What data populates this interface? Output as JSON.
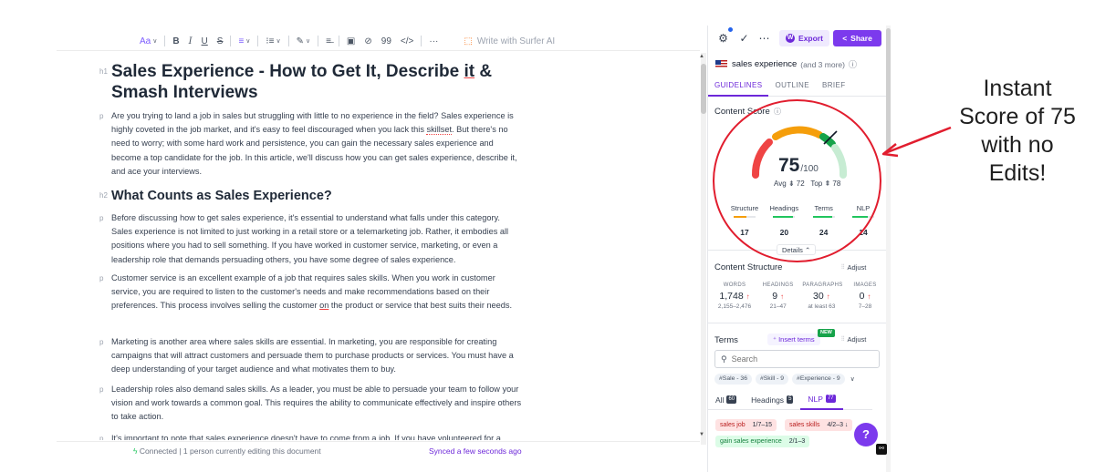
{
  "toolbar": {
    "text_style": "Aa",
    "bold": "B",
    "italic": "I",
    "underline": "U",
    "strike": "S",
    "align": "≡",
    "list": "⁝≡",
    "highlight": "✎",
    "clear": "≡̶",
    "image": "▣",
    "link": "⊘",
    "quote": "99",
    "code": "</>",
    "more": "···",
    "write_ai": "Write with Surfer AI"
  },
  "document": {
    "h1_tag": "h1",
    "h1_a": "Sales Experience - How to Get It, Describe ",
    "h1_b": "it",
    "h1_c": " & Smash Interviews",
    "p_tag": "p",
    "p1_a": "Are you trying to land a job in sales but struggling with little to no experience in the field? Sales experience is highly coveted in the job market, and it's easy to feel discouraged when you lack this ",
    "p1_b": "skillset",
    "p1_c": ". But there's no need to worry; with some hard work and persistence, you can gain the necessary sales experience and become a top candidate for the job. In this article, we'll discuss how you can get sales experience, describe it, and ace your interviews.",
    "h2_tag": "h2",
    "h2": "What Counts as Sales Experience?",
    "p2": "Before discussing how to get sales experience, it's essential to understand what falls under this category. Sales experience is not limited to just working in a retail store or a telemarketing job. Rather, it embodies all positions where you had to sell something. If you have worked in customer service, marketing, or even a leadership role that demands persuading others, you have some degree of sales experience.",
    "p3_a": "Customer service is an excellent example of a job that requires sales skills. When you work in customer service, you are required to listen to the customer's needs and make recommendations based on their preferences. This process involves selling the customer ",
    "p3_b": "on",
    "p3_c": " the product or service that best suits their needs.",
    "p4": "Marketing is another area where sales skills are essential. In marketing, you are responsible for creating campaigns that will attract customers and persuade them to purchase products or services. You must have a deep understanding of your target audience and what motivates them to buy.",
    "p5": "Leadership roles also demand sales skills. As a leader, you must be able to persuade your team to follow your vision and work towards a common goal. This requires the ability to communicate effectively and inspire others to take action.",
    "p6": "It's important to note that sales experience doesn't have to come from a job. If you have volunteered for a"
  },
  "status": {
    "connected": "Connected | 1 person currently editing this document",
    "synced": "Synced a few seconds ago"
  },
  "sidebar": {
    "export_label": "Export",
    "share_label": "Share",
    "keyword": "sales experience",
    "keyword_more": "(and 3 more)",
    "tabs": [
      "GUIDELINES",
      "OUTLINE",
      "BRIEF"
    ],
    "content_score_label": "Content Score",
    "score": "75",
    "score_max": "/100",
    "avg": "Avg ⇟ 72",
    "top": "Top ⇞ 78",
    "metrics": [
      {
        "label": "Structure",
        "value": "17",
        "fill": 0.6,
        "color": "#f59e0b"
      },
      {
        "label": "Headings",
        "value": "20",
        "fill": 0.9,
        "color": "#22c55e"
      },
      {
        "label": "Terms",
        "value": "24",
        "fill": 0.9,
        "color": "#22c55e"
      },
      {
        "label": "NLP",
        "value": "14",
        "fill": 0.7,
        "color": "#22c55e"
      }
    ],
    "details_label": "Details ⌃",
    "content_structure_label": "Content Structure",
    "adjust_label": "Adjust",
    "structure": [
      {
        "head": "WORDS",
        "value": "1,748",
        "range": "2,155–2,476"
      },
      {
        "head": "HEADINGS",
        "value": "9",
        "range": "21–47"
      },
      {
        "head": "PARAGRAPHS",
        "value": "30",
        "range": "at least 63"
      },
      {
        "head": "IMAGES",
        "value": "0",
        "range": "7–28"
      }
    ],
    "terms_label": "Terms",
    "insert_terms_label": "Insert terms",
    "new_badge": "NEW",
    "search_placeholder": "Search",
    "chips": [
      "#Sale - 36",
      "#Skill - 9",
      "#Experience - 9"
    ],
    "subtabs": [
      {
        "label": "All",
        "count": "60"
      },
      {
        "label": "Headings",
        "count": "5"
      },
      {
        "label": "NLP",
        "count": "77"
      }
    ],
    "terms": [
      {
        "name": "sales job",
        "count": "1/7–15"
      },
      {
        "name": "sales skills",
        "count": "4/2–3 ↓"
      },
      {
        "name": "gain sales experience",
        "count": "2/1–3"
      }
    ],
    "help_label": "?"
  },
  "annotation": {
    "line1": "Instant",
    "line2": "Score of 75",
    "line3": "with no",
    "line4": "Edits!",
    "color": "#e11d2e"
  }
}
